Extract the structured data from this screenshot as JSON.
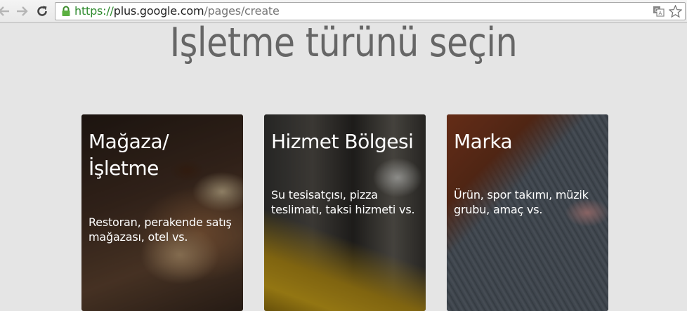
{
  "browser": {
    "url_scheme": "https://",
    "url_host": "plus.google.com",
    "url_path": "/pages/create"
  },
  "page": {
    "title": "Işletme türünü seçin"
  },
  "cards": [
    {
      "title": "Mağaza/\nİşletme",
      "description": "Restoran, perakende satış mağazası, otel vs."
    },
    {
      "title": "Hizmet Bölgesi",
      "description": "Su tesisatçısı, pizza teslimatı, taksi hizmeti vs."
    },
    {
      "title": "Marka",
      "description": "Ürün, spor takımı, müzik grubu, amaç vs."
    }
  ],
  "icons": {
    "back": "back-arrow-icon",
    "forward": "forward-arrow-icon",
    "reload": "reload-icon",
    "lock": "lock-icon",
    "translate": "translate-icon",
    "bookmark": "star-icon"
  },
  "colors": {
    "secure_scheme": "#2e8b2e",
    "page_background": "#e5e5e5"
  }
}
